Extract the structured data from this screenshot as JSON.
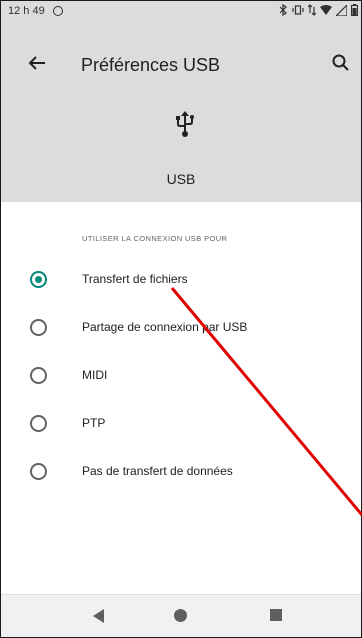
{
  "status_bar": {
    "time": "12 h 49"
  },
  "header": {
    "title": "Préférences USB",
    "device_label": "USB"
  },
  "section": {
    "header": "UTILISER LA CONNEXION USB POUR",
    "options": [
      {
        "label": "Transfert de fichiers",
        "checked": true
      },
      {
        "label": "Partage de connexion par USB",
        "checked": false
      },
      {
        "label": "MIDI",
        "checked": false
      },
      {
        "label": "PTP",
        "checked": false
      },
      {
        "label": "Pas de transfert de données",
        "checked": false
      }
    ]
  },
  "colors": {
    "accent": "#00897b",
    "header_bg": "#dcdcdc",
    "annotation": "#e00000"
  },
  "icons": [
    "back-arrow",
    "search",
    "usb",
    "nav-back",
    "nav-home",
    "nav-recents"
  ]
}
